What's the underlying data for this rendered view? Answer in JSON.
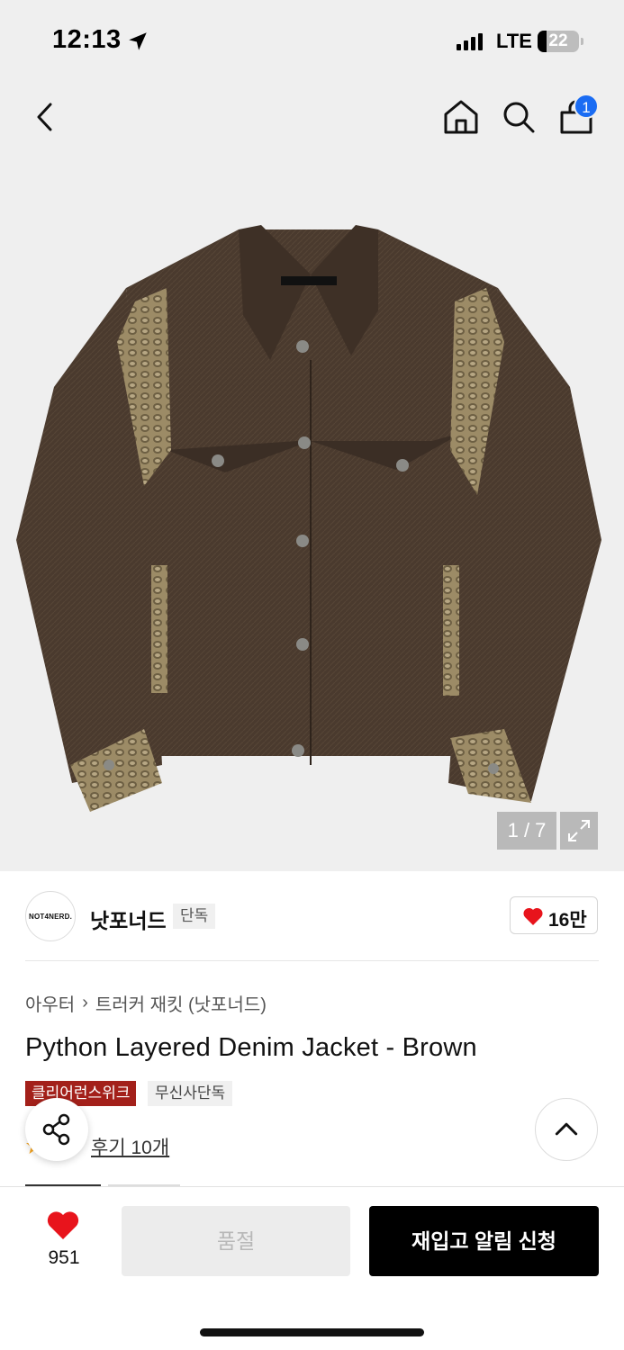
{
  "status_bar": {
    "time": "12:13",
    "network": "LTE",
    "battery": "22"
  },
  "nav": {
    "cart_count": "1"
  },
  "gallery": {
    "counter": "1 / 7",
    "jacket_label": "NOT4NERD."
  },
  "brand": {
    "logo_text": "NOT4NERD.",
    "name": "낫포너드",
    "tag": "단독",
    "like_count": "16만"
  },
  "breadcrumb": {
    "category": "아우터",
    "subcategory": "트러커 재킷 (낫포너드)"
  },
  "product": {
    "title": "Python Layered Denim Jacket - Brown",
    "tags": [
      "클리어런스위크",
      "무신사단독"
    ],
    "review_link": "후기 10개"
  },
  "bottom_bar": {
    "likes": "951",
    "sold_out_label": "품절",
    "restock_label": "재입고 알림 신청"
  },
  "colors": {
    "accent_red": "#e8141c",
    "tag_red": "#a3201a",
    "badge_blue": "#1a6cf3",
    "jacket_brown": "#4a3a2e",
    "snake_pattern": "#9c8b66"
  }
}
